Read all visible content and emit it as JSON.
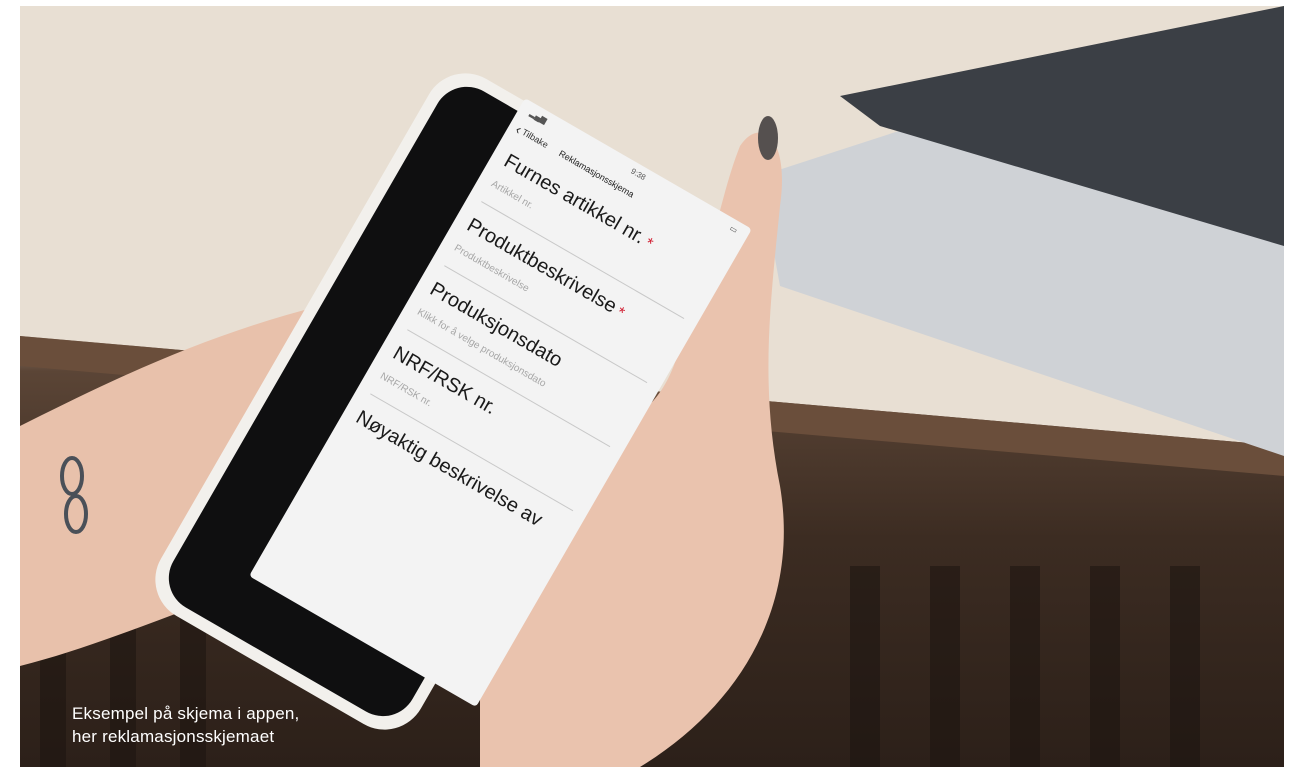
{
  "caption": {
    "line1": "Eksempel på skjema i appen,",
    "line2": "her reklamasjonsskjemaet"
  },
  "phone": {
    "status": {
      "time": "9:38"
    },
    "nav": {
      "back_label": "Tilbake",
      "title": "Reklamasjonsskjema"
    },
    "fields": [
      {
        "label": "Furnes artikkel nr.",
        "required": "*",
        "placeholder": "Artikkel nr."
      },
      {
        "label": "Produktbeskrivelse",
        "required": "*",
        "placeholder": "Produktbeskrivelse"
      },
      {
        "label": "Produksjonsdato",
        "required": "",
        "placeholder": "Klikk for å velge produksjonsdato"
      },
      {
        "label": "NRF/RSK nr.",
        "required": "",
        "placeholder": "NRF/RSK nr."
      },
      {
        "label": "Nøyaktig beskrivelse av",
        "required": "",
        "placeholder": ""
      }
    ]
  },
  "colors": {
    "required_marker": "#d0192d",
    "phone_case": "#f2f0ec",
    "skin": "#e9c2ad"
  }
}
